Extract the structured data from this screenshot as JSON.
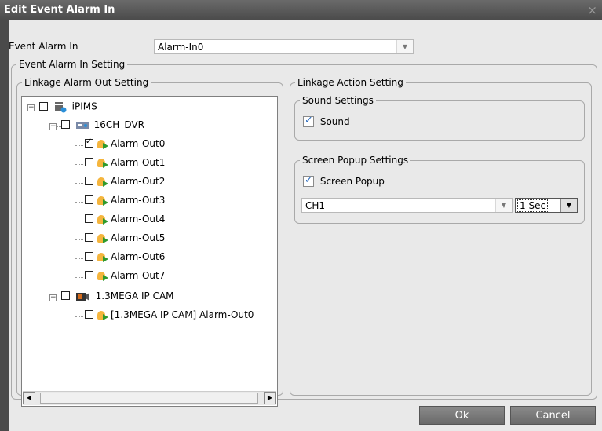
{
  "window": {
    "title": "Edit Event Alarm In",
    "close_glyph": "×"
  },
  "event_alarm_in": {
    "label": "Event Alarm In",
    "value": "Alarm-In0"
  },
  "groups": {
    "main": "Event Alarm In Setting",
    "linkage_alarm_out": "Linkage Alarm Out Setting",
    "linkage_action": "Linkage Action Setting",
    "sound_settings": "Sound Settings",
    "popup_settings": "Screen Popup Settings"
  },
  "tree": {
    "root": "iPIMS",
    "dvr": "16CH_DVR",
    "dvr_outputs": [
      {
        "label": "Alarm-Out0",
        "checked": true
      },
      {
        "label": "Alarm-Out1",
        "checked": false
      },
      {
        "label": "Alarm-Out2",
        "checked": false
      },
      {
        "label": "Alarm-Out3",
        "checked": false
      },
      {
        "label": "Alarm-Out4",
        "checked": false
      },
      {
        "label": "Alarm-Out5",
        "checked": false
      },
      {
        "label": "Alarm-Out6",
        "checked": false
      },
      {
        "label": "Alarm-Out7",
        "checked": false
      }
    ],
    "cam": "1.3MEGA IP CAM",
    "cam_output": "[1.3MEGA IP CAM] Alarm-Out0",
    "icons": {
      "root": "server-icon",
      "dvr": "dvr-icon",
      "cam": "camera-icon",
      "output": "alarm-bell-icon"
    }
  },
  "sound": {
    "label": "Sound",
    "checked": true
  },
  "popup": {
    "label": "Screen Popup",
    "checked": true,
    "channel": "CH1",
    "duration": "1 Sec"
  },
  "buttons": {
    "ok": "Ok",
    "cancel": "Cancel"
  },
  "colors": {
    "titlebar": "#4a4a4a",
    "client": "#e9e9e9",
    "check": "#2b6bbf"
  }
}
